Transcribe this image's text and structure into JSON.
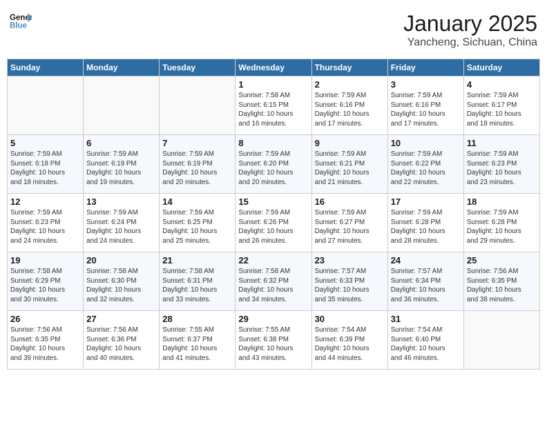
{
  "header": {
    "logo_line1": "General",
    "logo_line2": "Blue",
    "title": "January 2025",
    "subtitle": "Yancheng, Sichuan, China"
  },
  "weekdays": [
    "Sunday",
    "Monday",
    "Tuesday",
    "Wednesday",
    "Thursday",
    "Friday",
    "Saturday"
  ],
  "weeks": [
    [
      {
        "day": "",
        "info": ""
      },
      {
        "day": "",
        "info": ""
      },
      {
        "day": "",
        "info": ""
      },
      {
        "day": "1",
        "info": "Sunrise: 7:58 AM\nSunset: 6:15 PM\nDaylight: 10 hours\nand 16 minutes."
      },
      {
        "day": "2",
        "info": "Sunrise: 7:59 AM\nSunset: 6:16 PM\nDaylight: 10 hours\nand 17 minutes."
      },
      {
        "day": "3",
        "info": "Sunrise: 7:59 AM\nSunset: 6:16 PM\nDaylight: 10 hours\nand 17 minutes."
      },
      {
        "day": "4",
        "info": "Sunrise: 7:59 AM\nSunset: 6:17 PM\nDaylight: 10 hours\nand 18 minutes."
      }
    ],
    [
      {
        "day": "5",
        "info": "Sunrise: 7:59 AM\nSunset: 6:18 PM\nDaylight: 10 hours\nand 18 minutes."
      },
      {
        "day": "6",
        "info": "Sunrise: 7:59 AM\nSunset: 6:19 PM\nDaylight: 10 hours\nand 19 minutes."
      },
      {
        "day": "7",
        "info": "Sunrise: 7:59 AM\nSunset: 6:19 PM\nDaylight: 10 hours\nand 20 minutes."
      },
      {
        "day": "8",
        "info": "Sunrise: 7:59 AM\nSunset: 6:20 PM\nDaylight: 10 hours\nand 20 minutes."
      },
      {
        "day": "9",
        "info": "Sunrise: 7:59 AM\nSunset: 6:21 PM\nDaylight: 10 hours\nand 21 minutes."
      },
      {
        "day": "10",
        "info": "Sunrise: 7:59 AM\nSunset: 6:22 PM\nDaylight: 10 hours\nand 22 minutes."
      },
      {
        "day": "11",
        "info": "Sunrise: 7:59 AM\nSunset: 6:23 PM\nDaylight: 10 hours\nand 23 minutes."
      }
    ],
    [
      {
        "day": "12",
        "info": "Sunrise: 7:59 AM\nSunset: 6:23 PM\nDaylight: 10 hours\nand 24 minutes."
      },
      {
        "day": "13",
        "info": "Sunrise: 7:59 AM\nSunset: 6:24 PM\nDaylight: 10 hours\nand 24 minutes."
      },
      {
        "day": "14",
        "info": "Sunrise: 7:59 AM\nSunset: 6:25 PM\nDaylight: 10 hours\nand 25 minutes."
      },
      {
        "day": "15",
        "info": "Sunrise: 7:59 AM\nSunset: 6:26 PM\nDaylight: 10 hours\nand 26 minutes."
      },
      {
        "day": "16",
        "info": "Sunrise: 7:59 AM\nSunset: 6:27 PM\nDaylight: 10 hours\nand 27 minutes."
      },
      {
        "day": "17",
        "info": "Sunrise: 7:59 AM\nSunset: 6:28 PM\nDaylight: 10 hours\nand 28 minutes."
      },
      {
        "day": "18",
        "info": "Sunrise: 7:59 AM\nSunset: 6:28 PM\nDaylight: 10 hours\nand 29 minutes."
      }
    ],
    [
      {
        "day": "19",
        "info": "Sunrise: 7:58 AM\nSunset: 6:29 PM\nDaylight: 10 hours\nand 30 minutes."
      },
      {
        "day": "20",
        "info": "Sunrise: 7:58 AM\nSunset: 6:30 PM\nDaylight: 10 hours\nand 32 minutes."
      },
      {
        "day": "21",
        "info": "Sunrise: 7:58 AM\nSunset: 6:31 PM\nDaylight: 10 hours\nand 33 minutes."
      },
      {
        "day": "22",
        "info": "Sunrise: 7:58 AM\nSunset: 6:32 PM\nDaylight: 10 hours\nand 34 minutes."
      },
      {
        "day": "23",
        "info": "Sunrise: 7:57 AM\nSunset: 6:33 PM\nDaylight: 10 hours\nand 35 minutes."
      },
      {
        "day": "24",
        "info": "Sunrise: 7:57 AM\nSunset: 6:34 PM\nDaylight: 10 hours\nand 36 minutes."
      },
      {
        "day": "25",
        "info": "Sunrise: 7:56 AM\nSunset: 6:35 PM\nDaylight: 10 hours\nand 38 minutes."
      }
    ],
    [
      {
        "day": "26",
        "info": "Sunrise: 7:56 AM\nSunset: 6:35 PM\nDaylight: 10 hours\nand 39 minutes."
      },
      {
        "day": "27",
        "info": "Sunrise: 7:56 AM\nSunset: 6:36 PM\nDaylight: 10 hours\nand 40 minutes."
      },
      {
        "day": "28",
        "info": "Sunrise: 7:55 AM\nSunset: 6:37 PM\nDaylight: 10 hours\nand 41 minutes."
      },
      {
        "day": "29",
        "info": "Sunrise: 7:55 AM\nSunset: 6:38 PM\nDaylight: 10 hours\nand 43 minutes."
      },
      {
        "day": "30",
        "info": "Sunrise: 7:54 AM\nSunset: 6:39 PM\nDaylight: 10 hours\nand 44 minutes."
      },
      {
        "day": "31",
        "info": "Sunrise: 7:54 AM\nSunset: 6:40 PM\nDaylight: 10 hours\nand 46 minutes."
      },
      {
        "day": "",
        "info": ""
      }
    ]
  ]
}
